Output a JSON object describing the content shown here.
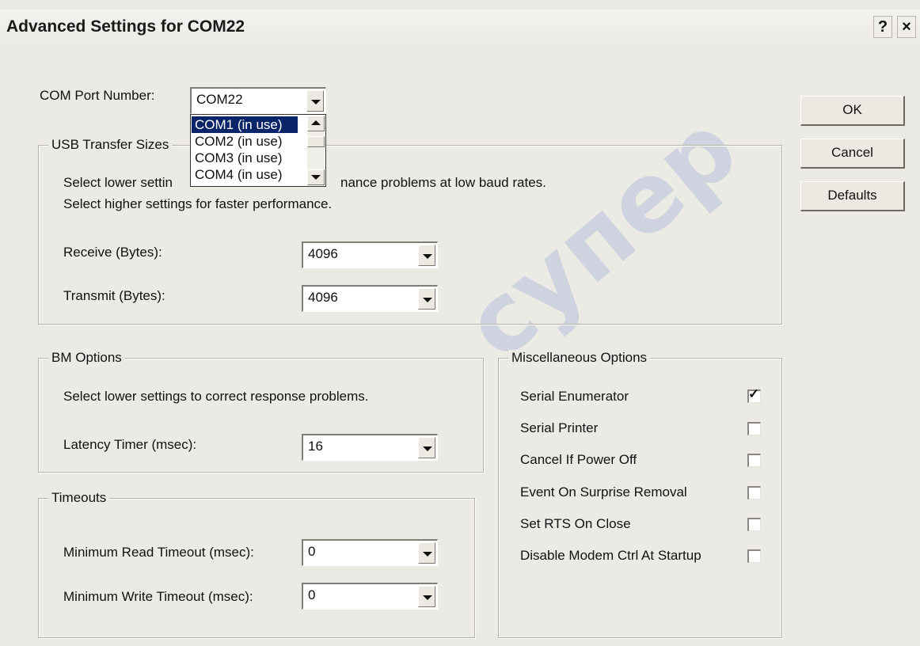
{
  "window": {
    "title": "Advanced Settings for COM22",
    "help_label": "?",
    "close_label": "×"
  },
  "com_port": {
    "label": "COM Port Number:",
    "value": "COM22",
    "dropdown_options": [
      "COM1 (in use)",
      "COM2 (in use)",
      "COM3 (in use)",
      "COM4 (in use)"
    ],
    "highlighted_option": "COM1 (in use)"
  },
  "usb": {
    "group_title": "USB Transfer Sizes",
    "desc_line1_part1": "Select lower settin",
    "desc_line1_part2": "nance problems at low baud rates.",
    "desc_line2": "Select higher settings for faster performance.",
    "receive_label": "Receive (Bytes):",
    "receive_value": "4096",
    "transmit_label": "Transmit (Bytes):",
    "transmit_value": "4096"
  },
  "bm": {
    "group_title": "BM Options",
    "desc": "Select lower settings to correct response problems.",
    "latency_label": "Latency Timer (msec):",
    "latency_value": "16"
  },
  "timeouts": {
    "group_title": "Timeouts",
    "min_read_label": "Minimum Read Timeout (msec):",
    "min_read_value": "0",
    "min_write_label": "Minimum Write Timeout (msec):",
    "min_write_value": "0"
  },
  "misc": {
    "group_title": "Miscellaneous Options",
    "options": [
      {
        "label": "Serial Enumerator",
        "checked": true
      },
      {
        "label": "Serial Printer",
        "checked": false
      },
      {
        "label": "Cancel If Power Off",
        "checked": false
      },
      {
        "label": "Event On Surprise Removal",
        "checked": false
      },
      {
        "label": "Set RTS On Close",
        "checked": false
      },
      {
        "label": "Disable Modem Ctrl At Startup",
        "checked": false
      }
    ]
  },
  "buttons": {
    "ok": "OK",
    "cancel": "Cancel",
    "defaults": "Defaults"
  },
  "checkmark_glyph": "✓",
  "watermark": "супер"
}
